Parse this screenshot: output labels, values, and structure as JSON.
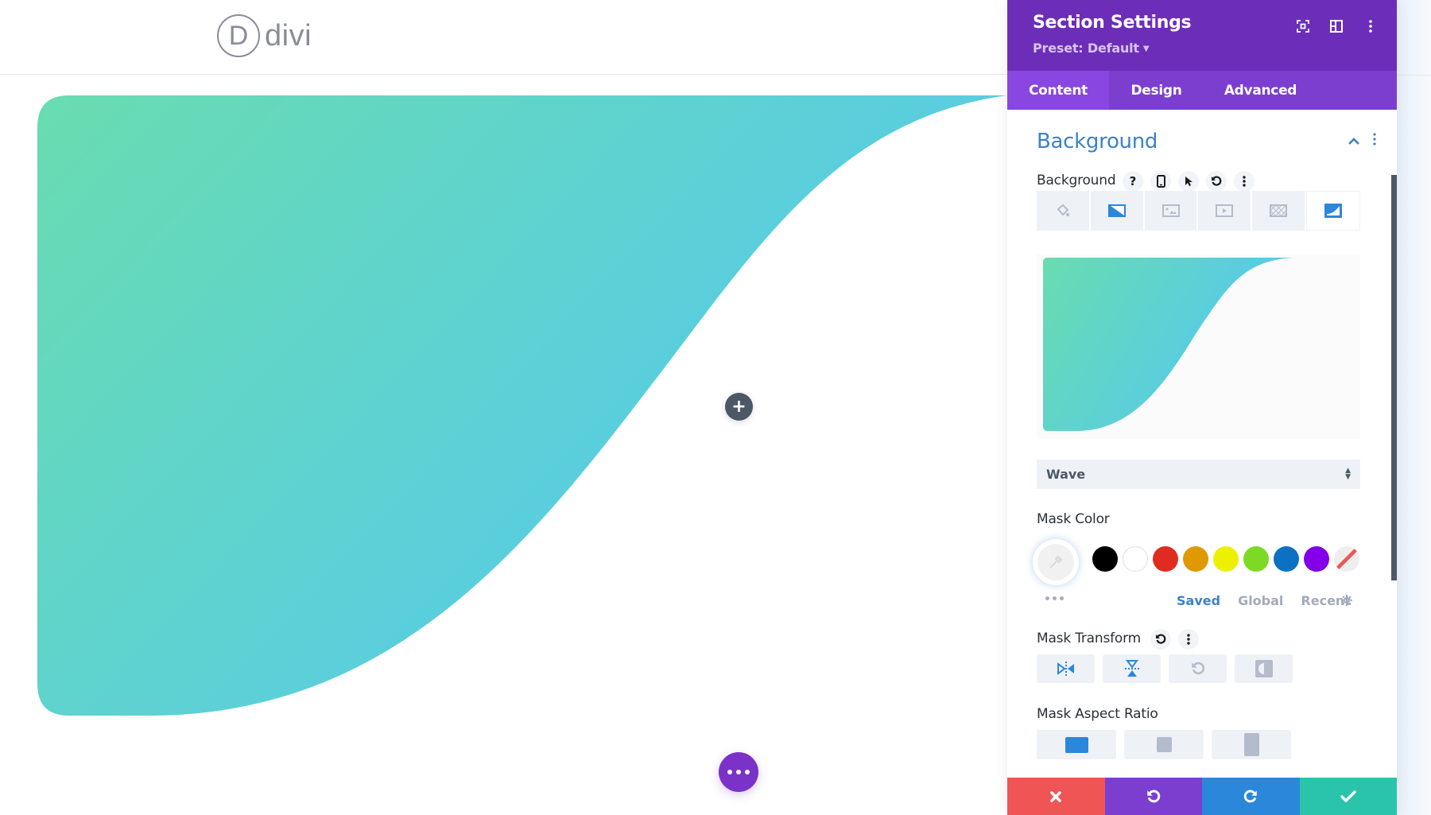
{
  "site": {
    "logo_letter": "D",
    "logo_text": "divi"
  },
  "canvas": {
    "wave_gradient": {
      "start": "#69dcb0",
      "end": "#53c8f2"
    },
    "add_button_icon": "plus-icon",
    "more_button_icon": "ellipsis-icon"
  },
  "panel": {
    "title": "Section Settings",
    "preset_label": "Preset: Default",
    "header_icons": [
      "focus-icon",
      "split-view-icon",
      "more-vertical-icon"
    ],
    "colors": {
      "header": "#6c2eb9",
      "tabs": "#7b3ecf",
      "tab_active": "#8a46e0",
      "accent": "#3b82c9"
    },
    "tabs": [
      {
        "label": "Content",
        "active": true
      },
      {
        "label": "Design",
        "active": false
      },
      {
        "label": "Advanced",
        "active": false
      }
    ],
    "section": {
      "title": "Background",
      "field_label": "Background",
      "field_tools": [
        "help-icon",
        "mobile-icon",
        "hover-cursor-icon",
        "reset-icon",
        "more-vertical-icon"
      ],
      "background_types": [
        {
          "name": "color",
          "icon": "paint-bucket-icon",
          "active": false
        },
        {
          "name": "gradient",
          "icon": "gradient-icon",
          "active": false
        },
        {
          "name": "image",
          "icon": "image-icon",
          "active": false
        },
        {
          "name": "video",
          "icon": "video-icon",
          "active": false
        },
        {
          "name": "pattern",
          "icon": "pattern-icon",
          "active": false
        },
        {
          "name": "mask",
          "icon": "mask-icon",
          "active": true
        }
      ],
      "mask_select_value": "Wave",
      "mask_color_label": "Mask Color",
      "swatches": [
        "#000000",
        "#ffffff",
        "#e02b20",
        "#e09900",
        "#edf000",
        "#7cda24",
        "#0c71c3",
        "#8300e9",
        "transparent"
      ],
      "palette_tabs": [
        {
          "label": "Saved",
          "active": true
        },
        {
          "label": "Global",
          "active": false
        },
        {
          "label": "Recent",
          "active": false
        }
      ],
      "mask_transform_label": "Mask Transform",
      "transform_buttons": [
        {
          "name": "flip-horizontal",
          "active": true
        },
        {
          "name": "flip-vertical",
          "active": true
        },
        {
          "name": "rotate",
          "active": false
        },
        {
          "name": "invert",
          "active": false
        }
      ],
      "aspect_ratio_label": "Mask Aspect Ratio",
      "aspect_ratio_buttons": [
        {
          "name": "landscape",
          "active": true
        },
        {
          "name": "square",
          "active": false
        },
        {
          "name": "portrait",
          "active": false
        }
      ]
    },
    "footer": [
      {
        "name": "cancel",
        "color": "#ef5555"
      },
      {
        "name": "undo",
        "color": "#7b3ecf"
      },
      {
        "name": "redo",
        "color": "#2b87da"
      },
      {
        "name": "save",
        "color": "#29c4a9"
      }
    ]
  }
}
